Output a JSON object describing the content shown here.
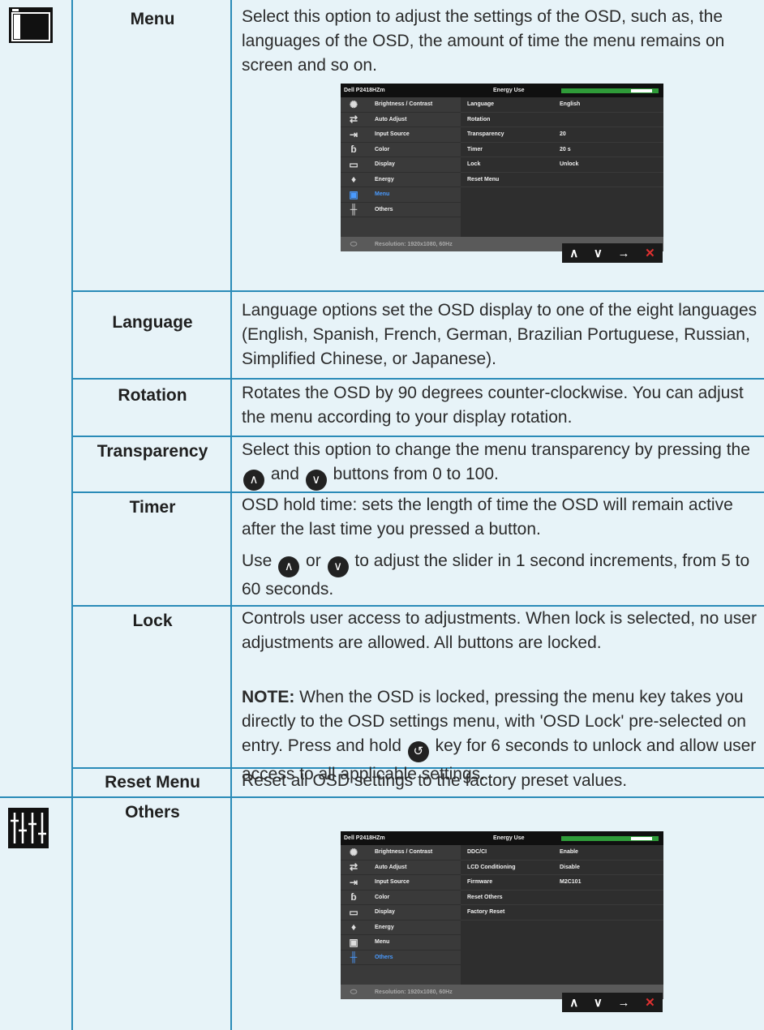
{
  "rows": {
    "menu": {
      "name": "Menu",
      "desc": "Select this option to adjust the settings of the OSD, such as, the languages of the OSD, the amount of time the menu remains on screen and so on."
    },
    "language": {
      "name": "Language",
      "desc": "Language options set the OSD display to one of the eight languages (English, Spanish, French, German, Brazilian Portuguese, Russian, Simplified Chinese, or Japanese)."
    },
    "rotation": {
      "name": "Rotation",
      "desc": "Rotates the OSD by 90 degrees counter-clockwise. You can adjust the menu according to your display rotation."
    },
    "transparency": {
      "name": "Transparency",
      "desc_a": "Select this option to change the menu transparency by pressing the",
      "desc_and": "and",
      "desc_b": "buttons from 0 to 100."
    },
    "timer": {
      "name": "Timer",
      "desc": "OSD hold time: sets the length of time the OSD will remain active after the last time you pressed a button.",
      "use": "Use",
      "or": "or",
      "desc2_b": "to adjust the slider in 1 second increments, from 5 to 60 seconds."
    },
    "lock": {
      "name": "Lock",
      "desc": "Controls user access to adjustments. When lock is selected, no user adjustments are allowed. All buttons are locked.",
      "note_label": "NOTE:",
      "note_a": "When the OSD is locked, pressing the menu key takes you directly to the OSD settings menu, with 'OSD Lock' pre-selected on entry. Press and hold",
      "note_b": "key for 6 seconds to unlock and allow user access to all applicable settings."
    },
    "reset": {
      "name": "Reset Menu",
      "desc": "Reset all OSD settings to the factory preset values."
    },
    "others": {
      "name": "Others"
    }
  },
  "osd": {
    "model": "Dell P2418HZm",
    "energy_use": "Energy Use",
    "menu_items": [
      "Brightness / Contrast",
      "Auto Adjust",
      "Input Source",
      "Color",
      "Display",
      "Energy",
      "Menu",
      "Others"
    ],
    "footer": "Resolution: 1920x1080, 60Hz",
    "menu_panel": [
      {
        "k": "Language",
        "v": "English"
      },
      {
        "k": "Rotation",
        "v": ""
      },
      {
        "k": "Transparency",
        "v": "20"
      },
      {
        "k": "Timer",
        "v": "20 s"
      },
      {
        "k": "Lock",
        "v": "Unlock"
      },
      {
        "k": "Reset Menu",
        "v": ""
      }
    ],
    "others_panel": [
      {
        "k": "DDC/CI",
        "v": "Enable"
      },
      {
        "k": "LCD Conditioning",
        "v": "Disable"
      },
      {
        "k": "Firmware",
        "v": "M2C101"
      },
      {
        "k": "Reset Others",
        "v": ""
      },
      {
        "k": "Factory Reset",
        "v": ""
      }
    ]
  },
  "icons": [
    "menu-icon",
    "others-icon",
    "up-button-icon",
    "down-button-icon",
    "back-button-icon"
  ]
}
